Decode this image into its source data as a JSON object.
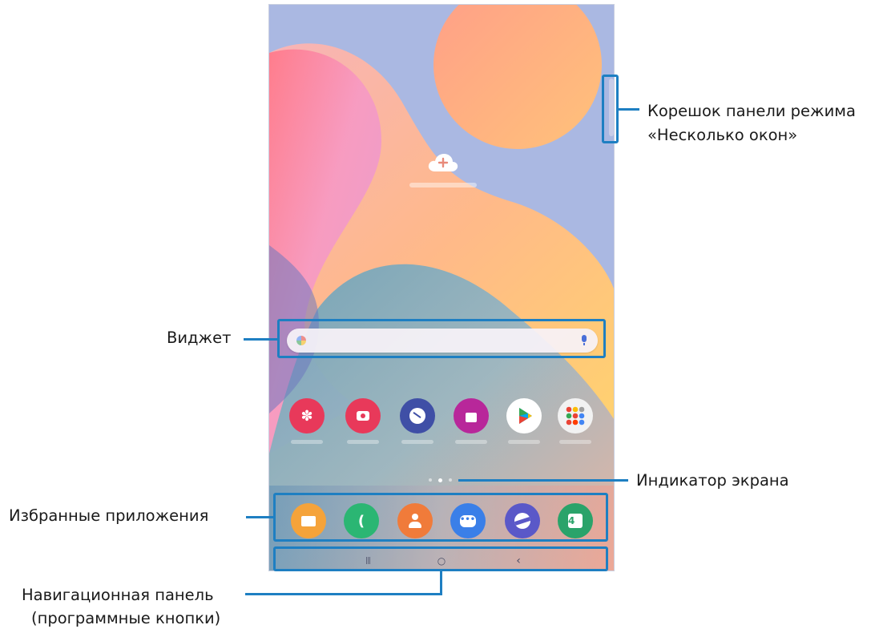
{
  "callouts": {
    "multi_window_handle": {
      "line1": "Корешок панели режима",
      "line2": "«Несколько окон»"
    },
    "widget": "Виджет",
    "screen_indicator": "Индикатор экрана",
    "favorites": "Избранные приложения",
    "navigation_bar": {
      "line1": "Навигационная панель",
      "line2": "(программные кнопки)"
    }
  },
  "colors": {
    "callout_accent": "#1e7fc2",
    "wallpaper_base": "#aab8e2"
  },
  "home_screen": {
    "add_account_icon": "cloud-add-icon",
    "apps_row": [
      {
        "icon": "gallery-icon",
        "color": "#e8395a"
      },
      {
        "icon": "camera-icon",
        "color": "#e8395a"
      },
      {
        "icon": "clock-icon",
        "color": "#3f4fa6"
      },
      {
        "icon": "galaxy-store-icon",
        "color": "#b8279a"
      },
      {
        "icon": "play-store-icon",
        "color": "#ffffff"
      },
      {
        "icon": "google-folder-icon",
        "color": "#f2f2f2"
      }
    ],
    "page_indicator": {
      "count": 3,
      "active_index": 1
    },
    "favorites": [
      {
        "icon": "my-files-icon",
        "color": "#f5a33a"
      },
      {
        "icon": "phone-icon",
        "color": "#2bb673"
      },
      {
        "icon": "contacts-icon",
        "color": "#f07b3a"
      },
      {
        "icon": "messages-icon",
        "color": "#3a7fe8"
      },
      {
        "icon": "internet-icon",
        "color": "#5a58c8"
      },
      {
        "icon": "calendar-icon",
        "color": "#2aa36a",
        "text": "4"
      }
    ],
    "nav_buttons": [
      {
        "icon": "recents-icon",
        "glyph": "|||"
      },
      {
        "icon": "home-icon",
        "glyph": "○"
      },
      {
        "icon": "back-icon",
        "glyph": "‹"
      }
    ]
  }
}
